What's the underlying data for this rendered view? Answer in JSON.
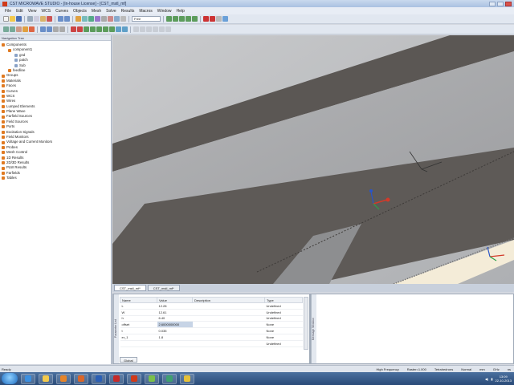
{
  "window": {
    "title": "CST MICROWAVE STUDIO - [In-house License] - [CST_mstl_mf]"
  },
  "menu": [
    "File",
    "Edit",
    "View",
    "WCS",
    "Curves",
    "Objects",
    "Mesh",
    "Solve",
    "Results",
    "Macros",
    "Window",
    "Help"
  ],
  "toolbar": {
    "combo_value": "Free"
  },
  "navigation": {
    "header": "Navigation Tree",
    "items": [
      {
        "label": "Components",
        "level": 0
      },
      {
        "label": "component1",
        "level": 1
      },
      {
        "label": "gnd",
        "level": 2
      },
      {
        "label": "patch",
        "level": 2
      },
      {
        "label": "Sub",
        "level": 2
      },
      {
        "label": "feedline",
        "level": 1
      },
      {
        "label": "Groups",
        "level": 0
      },
      {
        "label": "Materials",
        "level": 0
      },
      {
        "label": "Faces",
        "level": 0
      },
      {
        "label": "Curves",
        "level": 0
      },
      {
        "label": "WCS",
        "level": 0
      },
      {
        "label": "Wires",
        "level": 0
      },
      {
        "label": "Lumped Elements",
        "level": 0
      },
      {
        "label": "Plane Wave",
        "level": 0
      },
      {
        "label": "Farfield Sources",
        "level": 0
      },
      {
        "label": "Field Sources",
        "level": 0
      },
      {
        "label": "Ports",
        "level": 0
      },
      {
        "label": "Excitation Signals",
        "level": 0
      },
      {
        "label": "Field Monitors",
        "level": 0
      },
      {
        "label": "Voltage and Current Monitors",
        "level": 0
      },
      {
        "label": "Probes",
        "level": 0
      },
      {
        "label": "Mesh Control",
        "level": 0
      },
      {
        "label": "1D Results",
        "level": 0
      },
      {
        "label": "2D/3D Results",
        "level": 0
      },
      {
        "label": "PLW Results",
        "level": 0
      },
      {
        "label": "Farfields",
        "level": 0
      },
      {
        "label": "Tables",
        "level": 0
      }
    ]
  },
  "view_tabs": [
    "CST_mstl_mf*",
    "CST_mstl_mf*"
  ],
  "parameters": {
    "side_label": "Parameter List",
    "headers": [
      "Name",
      "Value",
      "Description",
      "Type"
    ],
    "rows": [
      {
        "name": "L",
        "value": "12.28",
        "description": "",
        "type": "Undefined"
      },
      {
        "name": "W",
        "value": "12.61",
        "description": "",
        "type": "Undefined"
      },
      {
        "name": "h",
        "value": "6.40",
        "description": "",
        "type": "Undefined"
      },
      {
        "name": "offset",
        "value": "2.6000000000",
        "description": "",
        "type": "None"
      },
      {
        "name": "t",
        "value": "0.035",
        "description": "",
        "type": "None"
      },
      {
        "name": "er_1",
        "value": "1.8",
        "description": "",
        "type": "None"
      },
      {
        "name": "",
        "value": "",
        "description": "",
        "type": "Undefined"
      }
    ],
    "bottom_tab": "Global"
  },
  "messages": {
    "side_label": "Message Window"
  },
  "status": {
    "left": "Ready",
    "items": [
      "High Frequency",
      "Raster=1.000",
      "Tetrahedrons",
      "Normal",
      "mm",
      "GHz",
      "ns"
    ]
  },
  "taskbar": {
    "time": "13:09",
    "date": "22-10-2013"
  },
  "colors": {
    "viewport_bg": "#bfc1c4",
    "dark_strip": "#5b5754",
    "light_strip": "#a6a7a9",
    "dielectric": "#f4ecd8",
    "accent_red": "#d03a1a"
  }
}
